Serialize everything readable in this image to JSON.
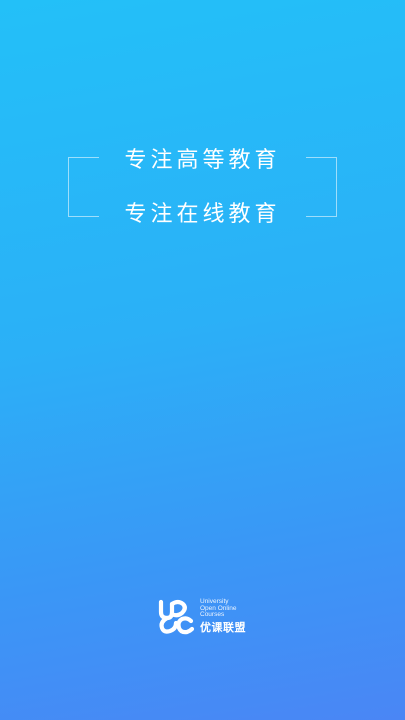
{
  "splash": {
    "slogan_line_1": "专注高等教育",
    "slogan_line_2": "专注在线教育"
  },
  "logo": {
    "icon": "uoc-logo-icon",
    "en_line_1": "University",
    "en_line_2": "Open Online",
    "en_line_3": "Courses",
    "cn_name": "优课联盟"
  },
  "colors": {
    "background_top": "#23c0f8",
    "background_bottom": "#4a86f5",
    "text": "#ffffff"
  }
}
